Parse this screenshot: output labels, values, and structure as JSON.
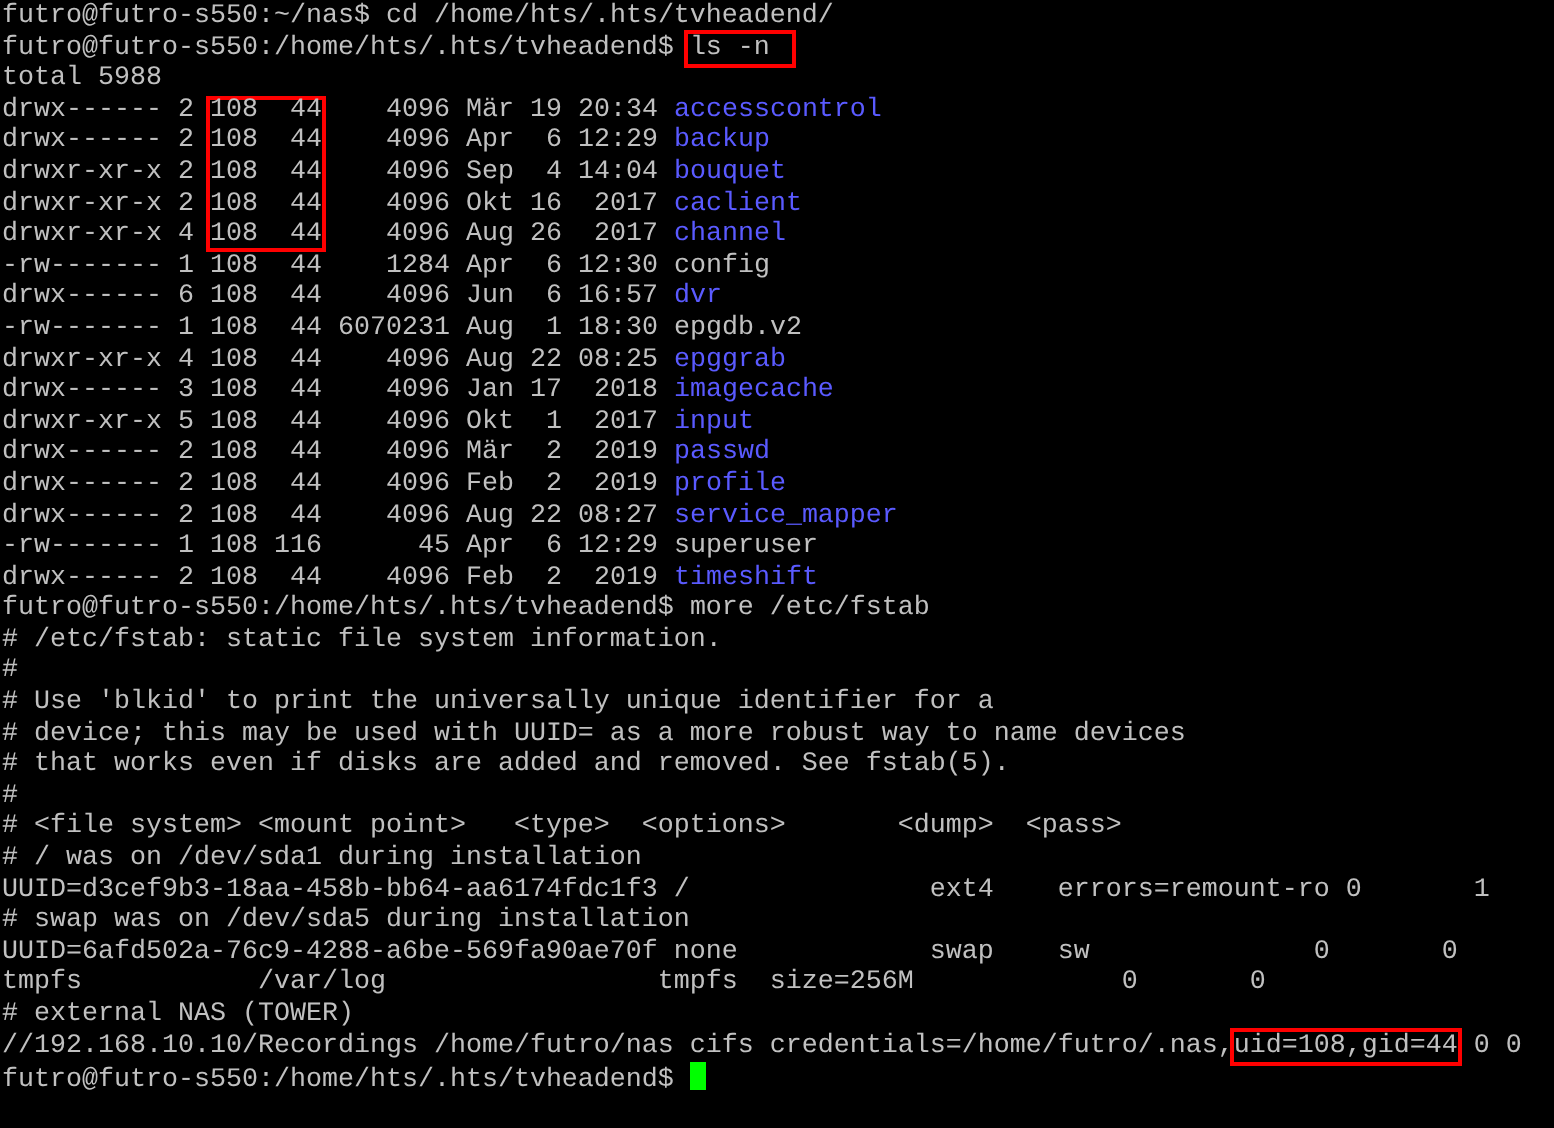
{
  "terminal": {
    "lines": [
      {
        "kind": "command",
        "prompt": "futro@futro-s550:~/nas$",
        "command": "cd /home/hts/.hts/tvheadend/",
        "highlighted": false
      },
      {
        "kind": "command",
        "prompt": "futro@futro-s550:/home/hts/.hts/tvheadend$",
        "command": "ls -n",
        "highlighted": true
      },
      {
        "kind": "text",
        "text": "total 5988"
      },
      {
        "kind": "entry",
        "mode": "drwx------",
        "links": "2",
        "owner": "108",
        "group": "44",
        "size": "4096",
        "date": "Mär 19 20:34",
        "name": "accesscontrol",
        "directory": true,
        "ids_highlighted": true
      },
      {
        "kind": "entry",
        "mode": "drwx------",
        "links": "2",
        "owner": "108",
        "group": "44",
        "size": "4096",
        "date": "Apr  6 12:29",
        "name": "backup",
        "directory": true,
        "ids_highlighted": true
      },
      {
        "kind": "entry",
        "mode": "drwxr-xr-x",
        "links": "2",
        "owner": "108",
        "group": "44",
        "size": "4096",
        "date": "Sep  4 14:04",
        "name": "bouquet",
        "directory": true,
        "ids_highlighted": true
      },
      {
        "kind": "entry",
        "mode": "drwxr-xr-x",
        "links": "2",
        "owner": "108",
        "group": "44",
        "size": "4096",
        "date": "Okt 16  2017",
        "name": "caclient",
        "directory": true,
        "ids_highlighted": true
      },
      {
        "kind": "entry",
        "mode": "drwxr-xr-x",
        "links": "4",
        "owner": "108",
        "group": "44",
        "size": "4096",
        "date": "Aug 26  2017",
        "name": "channel",
        "directory": true,
        "ids_highlighted": true
      },
      {
        "kind": "entry",
        "mode": "-rw-------",
        "links": "1",
        "owner": "108",
        "group": "44",
        "size": "1284",
        "date": "Apr  6 12:30",
        "name": "config",
        "directory": false,
        "ids_highlighted": false
      },
      {
        "kind": "entry",
        "mode": "drwx------",
        "links": "6",
        "owner": "108",
        "group": "44",
        "size": "4096",
        "date": "Jun  6 16:57",
        "name": "dvr",
        "directory": true,
        "ids_highlighted": false
      },
      {
        "kind": "entry",
        "mode": "-rw-------",
        "links": "1",
        "owner": "108",
        "group": "44",
        "size": "6070231",
        "date": "Aug  1 18:30",
        "name": "epgdb.v2",
        "directory": false,
        "ids_highlighted": false
      },
      {
        "kind": "entry",
        "mode": "drwxr-xr-x",
        "links": "4",
        "owner": "108",
        "group": "44",
        "size": "4096",
        "date": "Aug 22 08:25",
        "name": "epggrab",
        "directory": true,
        "ids_highlighted": false
      },
      {
        "kind": "entry",
        "mode": "drwx------",
        "links": "3",
        "owner": "108",
        "group": "44",
        "size": "4096",
        "date": "Jan 17  2018",
        "name": "imagecache",
        "directory": true,
        "ids_highlighted": false
      },
      {
        "kind": "entry",
        "mode": "drwxr-xr-x",
        "links": "5",
        "owner": "108",
        "group": "44",
        "size": "4096",
        "date": "Okt  1  2017",
        "name": "input",
        "directory": true,
        "ids_highlighted": false
      },
      {
        "kind": "entry",
        "mode": "drwx------",
        "links": "2",
        "owner": "108",
        "group": "44",
        "size": "4096",
        "date": "Mär  2  2019",
        "name": "passwd",
        "directory": true,
        "ids_highlighted": false
      },
      {
        "kind": "entry",
        "mode": "drwx------",
        "links": "2",
        "owner": "108",
        "group": "44",
        "size": "4096",
        "date": "Feb  2  2019",
        "name": "profile",
        "directory": true,
        "ids_highlighted": false
      },
      {
        "kind": "entry",
        "mode": "drwx------",
        "links": "2",
        "owner": "108",
        "group": "44",
        "size": "4096",
        "date": "Aug 22 08:27",
        "name": "service_mapper",
        "directory": true,
        "ids_highlighted": false
      },
      {
        "kind": "entry",
        "mode": "-rw-------",
        "links": "1",
        "owner": "108",
        "group": "116",
        "size": "45",
        "date": "Apr  6 12:29",
        "name": "superuser",
        "directory": false,
        "ids_highlighted": false
      },
      {
        "kind": "entry",
        "mode": "drwx------",
        "links": "2",
        "owner": "108",
        "group": "44",
        "size": "4096",
        "date": "Feb  2  2019",
        "name": "timeshift",
        "directory": true,
        "ids_highlighted": false
      },
      {
        "kind": "command",
        "prompt": "futro@futro-s550:/home/hts/.hts/tvheadend$",
        "command": "more /etc/fstab",
        "highlighted": false
      },
      {
        "kind": "text",
        "text": "# /etc/fstab: static file system information."
      },
      {
        "kind": "text",
        "text": "#"
      },
      {
        "kind": "text",
        "text": "# Use 'blkid' to print the universally unique identifier for a"
      },
      {
        "kind": "text",
        "text": "# device; this may be used with UUID= as a more robust way to name devices"
      },
      {
        "kind": "text",
        "text": "# that works even if disks are added and removed. See fstab(5)."
      },
      {
        "kind": "text",
        "text": "#"
      },
      {
        "kind": "text",
        "text": "# <file system> <mount point>   <type>  <options>       <dump>  <pass>"
      },
      {
        "kind": "text",
        "text": "# / was on /dev/sda1 during installation"
      },
      {
        "kind": "text",
        "text": "UUID=d3cef9b3-18aa-458b-bb64-aa6174fdc1f3 /               ext4    errors=remount-ro 0       1"
      },
      {
        "kind": "text",
        "text": "# swap was on /dev/sda5 during installation"
      },
      {
        "kind": "text",
        "text": "UUID=6afd502a-76c9-4288-a6be-569fa90ae70f none            swap    sw              0       0"
      },
      {
        "kind": "text",
        "text": "tmpfs           /var/log                 tmpfs  size=256M             0       0"
      },
      {
        "kind": "text",
        "text": "# external NAS (TOWER)"
      },
      {
        "kind": "marked_text",
        "before": "//192.168.10.10/Recordings /home/futro/nas cifs credentials=/home/futro/.nas,",
        "marked": "uid=108,gid=44",
        "after": " 0 0"
      },
      {
        "kind": "prompt",
        "prompt": "futro@futro-s550:/home/hts/.hts/tvheadend$",
        "cursor": true
      }
    ]
  }
}
